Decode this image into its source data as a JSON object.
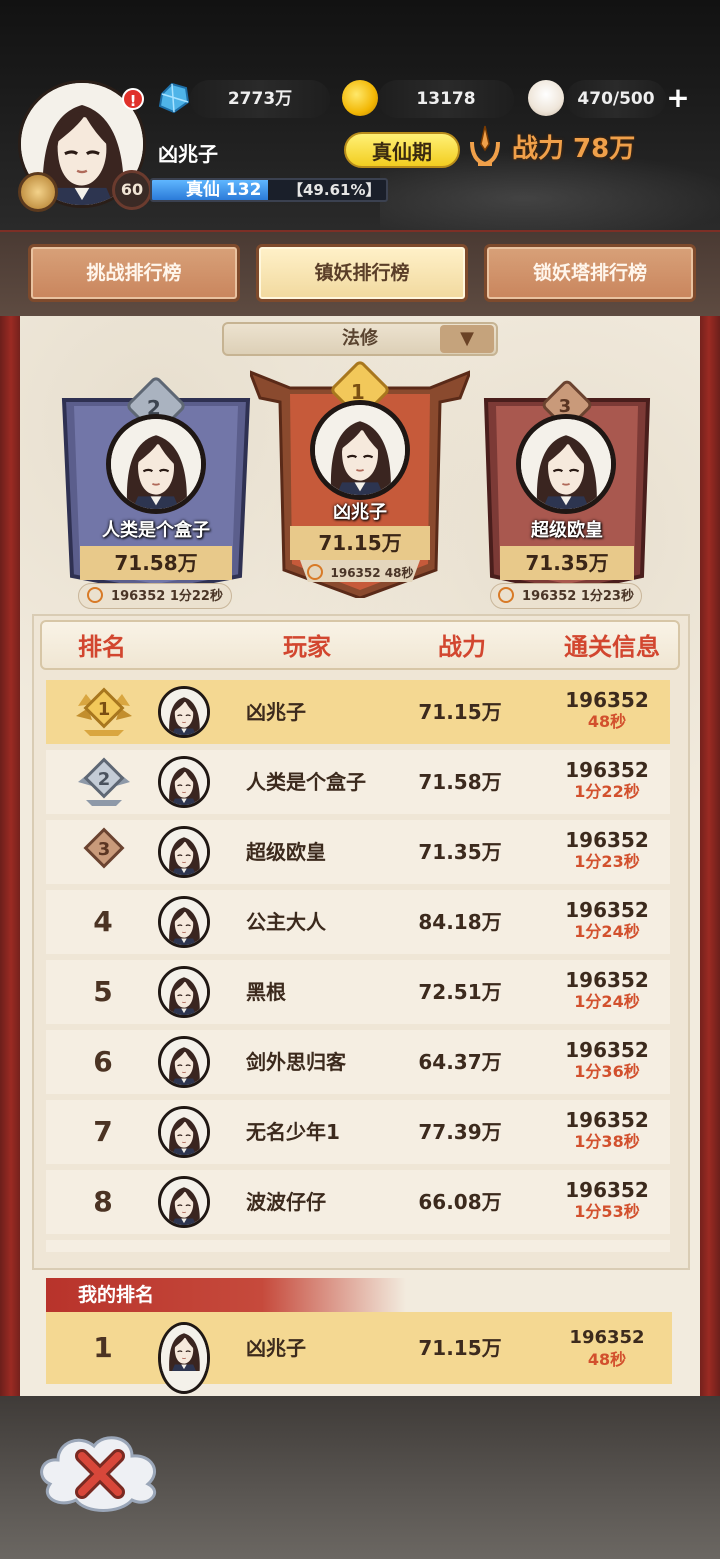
{
  "header": {
    "player_name": "凶兆子",
    "level": "60",
    "alert": "!",
    "gems": "2773万",
    "gold": "13178",
    "stamina": "470/500",
    "plus": "+",
    "realm_tag": "真仙期",
    "power": "战力 78万",
    "exp_label": "真仙 132",
    "exp_pct": "【49.61%】",
    "exp_fraction": 0.4961
  },
  "tabs": [
    {
      "label": "挑战排行榜",
      "active": false
    },
    {
      "label": "镇妖排行榜",
      "active": true
    },
    {
      "label": "锁妖塔排行榜",
      "active": false
    }
  ],
  "filter": {
    "selected": "法修"
  },
  "podium": {
    "first": {
      "rank": "1",
      "name": "凶兆子",
      "power": "71.15万",
      "time": "196352 48秒"
    },
    "second": {
      "rank": "2",
      "name": "人类是个盒子",
      "power": "71.58万",
      "time": "196352 1分22秒"
    },
    "third": {
      "rank": "3",
      "name": "超级欧皇",
      "power": "71.35万",
      "time": "196352 1分23秒"
    }
  },
  "table": {
    "headers": [
      "排名",
      "玩家",
      "战力",
      "通关信息"
    ],
    "rows": [
      {
        "rank": "1",
        "name": "凶兆子",
        "power": "71.15万",
        "score": "196352",
        "time": "48秒"
      },
      {
        "rank": "2",
        "name": "人类是个盒子",
        "power": "71.58万",
        "score": "196352",
        "time": "1分22秒"
      },
      {
        "rank": "3",
        "name": "超级欧皇",
        "power": "71.35万",
        "score": "196352",
        "time": "1分23秒"
      },
      {
        "rank": "4",
        "name": "公主大人",
        "power": "84.18万",
        "score": "196352",
        "time": "1分24秒"
      },
      {
        "rank": "5",
        "name": "黑根",
        "power": "72.51万",
        "score": "196352",
        "time": "1分24秒"
      },
      {
        "rank": "6",
        "name": "剑外思归客",
        "power": "64.37万",
        "score": "196352",
        "time": "1分36秒"
      },
      {
        "rank": "7",
        "name": "无名少年1",
        "power": "77.39万",
        "score": "196352",
        "time": "1分38秒"
      },
      {
        "rank": "8",
        "name": "波波仔仔",
        "power": "66.08万",
        "score": "196352",
        "time": "1分53秒"
      }
    ]
  },
  "my_rank": {
    "title": "我的排名",
    "rank": "1",
    "name": "凶兆子",
    "power": "71.15万",
    "score": "196352",
    "time": "48秒"
  },
  "colors": {
    "accent_red": "#d2462f",
    "gold_row": "#f4d892",
    "panel_bg": "#f2ebde"
  }
}
